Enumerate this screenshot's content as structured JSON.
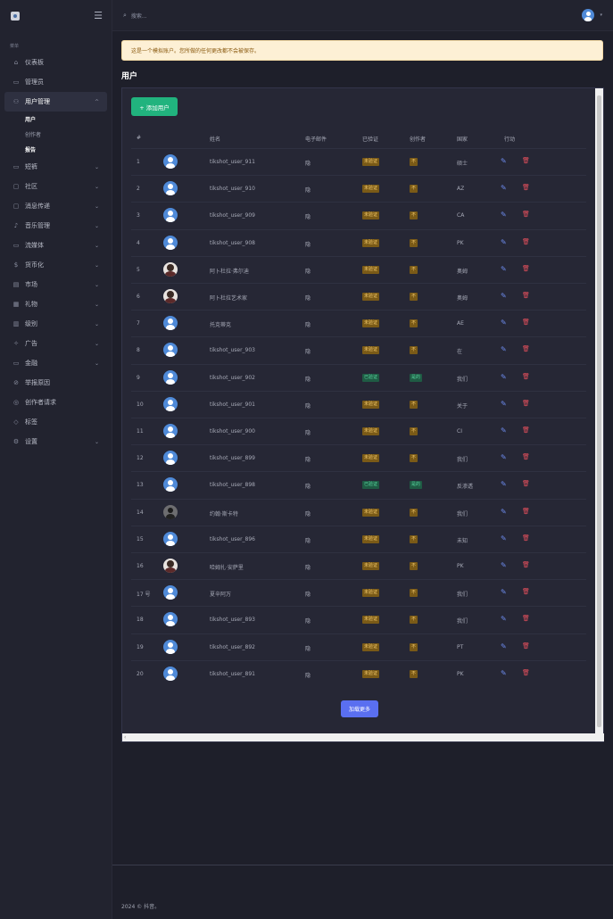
{
  "sidebar": {
    "section_label": "菜单",
    "items": [
      {
        "label": "仪表板",
        "icon": "home-icon",
        "glyph": "⌂",
        "chevron": ""
      },
      {
        "label": "管理员",
        "icon": "admin-icon",
        "glyph": "▭",
        "chevron": ""
      },
      {
        "label": "用户管理",
        "icon": "users-icon",
        "glyph": "⚇",
        "chevron": "^",
        "active": true
      },
      {
        "label": "短裤",
        "icon": "video-icon",
        "glyph": "▭",
        "chevron": "⌄"
      },
      {
        "label": "社区",
        "icon": "chat-icon",
        "glyph": "▢",
        "chevron": "⌄"
      },
      {
        "label": "消息传递",
        "icon": "message-icon",
        "glyph": "▢",
        "chevron": "⌄"
      },
      {
        "label": "音乐管理",
        "icon": "music-icon",
        "glyph": "♪",
        "chevron": "⌄"
      },
      {
        "label": "流媒体",
        "icon": "stream-icon",
        "glyph": "▭",
        "chevron": "⌄"
      },
      {
        "label": "货币化",
        "icon": "dollar-icon",
        "glyph": "$",
        "chevron": "⌄"
      },
      {
        "label": "市场",
        "icon": "market-icon",
        "glyph": "▤",
        "chevron": "⌄"
      },
      {
        "label": "礼物",
        "icon": "gift-icon",
        "glyph": "▦",
        "chevron": "⌄"
      },
      {
        "label": "级别",
        "icon": "level-icon",
        "glyph": "▥",
        "chevron": "⌄"
      },
      {
        "label": "广告",
        "icon": "ad-icon",
        "glyph": "✧",
        "chevron": "⌄"
      },
      {
        "label": "金融",
        "icon": "wallet-icon",
        "glyph": "▭",
        "chevron": "⌄"
      },
      {
        "label": "举报原因",
        "icon": "ban-icon",
        "glyph": "⊘",
        "chevron": ""
      },
      {
        "label": "创作者请求",
        "icon": "request-icon",
        "glyph": "◎",
        "chevron": ""
      },
      {
        "label": "标签",
        "icon": "tag-icon",
        "glyph": "◇",
        "chevron": ""
      },
      {
        "label": "设置",
        "icon": "settings-icon",
        "glyph": "⚙",
        "chevron": "⌄"
      }
    ],
    "sub_items": [
      {
        "label": "用户",
        "on": true
      },
      {
        "label": "创作者",
        "on": false
      },
      {
        "label": "报告",
        "on": true
      }
    ]
  },
  "topbar": {
    "search_placeholder": "搜索..."
  },
  "alert": {
    "text": "这是一个模拟账户。您所做的任何更改都不会被保存。"
  },
  "page": {
    "title": "用户"
  },
  "buttons": {
    "add_user": "+ 添加用户",
    "load_more": "加载更多"
  },
  "table": {
    "columns": [
      "#",
      "姓名",
      "电子邮件",
      "已验证",
      "创作者",
      "国家",
      "行动"
    ],
    "rows": [
      {
        "num": "1",
        "name": "tikshot_user_911",
        "email": "隐",
        "verified": "未验证",
        "vstate": "warn",
        "creator": "不",
        "cstate": "warn",
        "country": "硕士",
        "avatar": "default"
      },
      {
        "num": "2",
        "name": "tikshot_user_910",
        "email": "隐",
        "verified": "未验证",
        "vstate": "warn",
        "creator": "不",
        "cstate": "warn",
        "country": "AZ",
        "avatar": "default"
      },
      {
        "num": "3",
        "name": "tikshot_user_909",
        "email": "隐",
        "verified": "未验证",
        "vstate": "warn",
        "creator": "不",
        "cstate": "warn",
        "country": "CA",
        "avatar": "default"
      },
      {
        "num": "4",
        "name": "tikshot_user_908",
        "email": "隐",
        "verified": "未验证",
        "vstate": "warn",
        "creator": "不",
        "cstate": "warn",
        "country": "PK",
        "avatar": "default"
      },
      {
        "num": "5",
        "name": "阿卜杜拉·弗尔迪",
        "email": "隐",
        "verified": "未验证",
        "vstate": "warn",
        "creator": "不",
        "cstate": "warn",
        "country": "奥姆",
        "avatar": "photo"
      },
      {
        "num": "6",
        "name": "阿卜杜拉艺术家",
        "email": "隐",
        "verified": "未验证",
        "vstate": "warn",
        "creator": "不",
        "cstate": "warn",
        "country": "奥姆",
        "avatar": "photo"
      },
      {
        "num": "7",
        "name": "托克蒂克",
        "email": "隐",
        "verified": "未验证",
        "vstate": "warn",
        "creator": "不",
        "cstate": "warn",
        "country": "AE",
        "avatar": "default"
      },
      {
        "num": "8",
        "name": "tikshot_user_903",
        "email": "隐",
        "verified": "未验证",
        "vstate": "warn",
        "creator": "不",
        "cstate": "warn",
        "country": "在",
        "avatar": "default"
      },
      {
        "num": "9",
        "name": "tikshot_user_902",
        "email": "隐",
        "verified": "已验证",
        "vstate": "ok",
        "creator": "是的",
        "cstate": "ok",
        "country": "我们",
        "avatar": "default"
      },
      {
        "num": "10",
        "name": "tikshot_user_901",
        "email": "隐",
        "verified": "未验证",
        "vstate": "warn",
        "creator": "不",
        "cstate": "warn",
        "country": "关于",
        "avatar": "default"
      },
      {
        "num": "11",
        "name": "tikshot_user_900",
        "email": "隐",
        "verified": "未验证",
        "vstate": "warn",
        "creator": "不",
        "cstate": "warn",
        "country": "CI",
        "avatar": "default"
      },
      {
        "num": "12",
        "name": "tikshot_user_899",
        "email": "隐",
        "verified": "未验证",
        "vstate": "warn",
        "creator": "不",
        "cstate": "warn",
        "country": "我们",
        "avatar": "default"
      },
      {
        "num": "13",
        "name": "tikshot_user_898",
        "email": "隐",
        "verified": "已验证",
        "vstate": "ok",
        "creator": "是的",
        "cstate": "ok",
        "country": "反渗透",
        "avatar": "default"
      },
      {
        "num": "14",
        "name": "约翰·斯卡特",
        "email": "隐",
        "verified": "未验证",
        "vstate": "warn",
        "creator": "不",
        "cstate": "warn",
        "country": "我们",
        "avatar": "dark"
      },
      {
        "num": "15",
        "name": "tikshot_user_896",
        "email": "隐",
        "verified": "未验证",
        "vstate": "warn",
        "creator": "不",
        "cstate": "warn",
        "country": "未知",
        "avatar": "default"
      },
      {
        "num": "16",
        "name": "哈姆扎·安萨里",
        "email": "隐",
        "verified": "未验证",
        "vstate": "warn",
        "creator": "不",
        "cstate": "warn",
        "country": "PK",
        "avatar": "photo"
      },
      {
        "num": "17 号",
        "name": "夏辛阿万",
        "email": "隐",
        "verified": "未验证",
        "vstate": "warn",
        "creator": "不",
        "cstate": "warn",
        "country": "我们",
        "avatar": "default"
      },
      {
        "num": "18",
        "name": "tikshot_user_893",
        "email": "隐",
        "verified": "未验证",
        "vstate": "warn",
        "creator": "不",
        "cstate": "warn",
        "country": "我们",
        "avatar": "default"
      },
      {
        "num": "19",
        "name": "tikshot_user_892",
        "email": "隐",
        "verified": "未验证",
        "vstate": "warn",
        "creator": "不",
        "cstate": "warn",
        "country": "PT",
        "avatar": "default"
      },
      {
        "num": "20",
        "name": "tikshot_user_891",
        "email": "隐",
        "verified": "未验证",
        "vstate": "warn",
        "creator": "不",
        "cstate": "warn",
        "country": "PK",
        "avatar": "default"
      }
    ]
  },
  "footer": {
    "text": "2024 © 抖音。"
  },
  "colors": {
    "accent_green": "#21b37e",
    "accent_blue": "#5a6ff0",
    "warn_badge": "#7a5a17",
    "ok_badge": "#1f5b44"
  }
}
